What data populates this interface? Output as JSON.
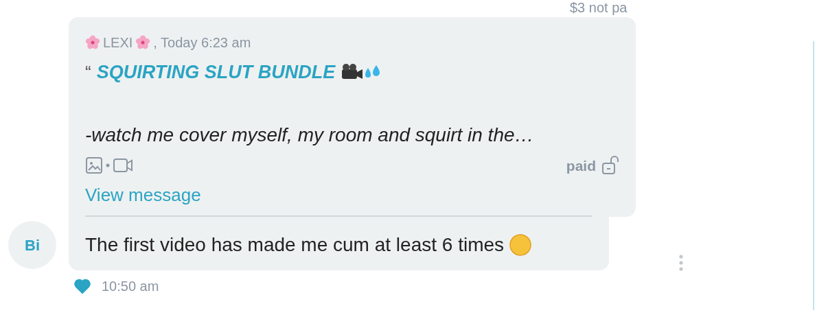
{
  "top_note": "$3 not pa",
  "avatar": {
    "initials": "Bi"
  },
  "quoted": {
    "sender": "LEXI",
    "time": ", Today 6:23 am",
    "quote_mark": "“",
    "title": "SQUIRTING SLUT BUNDLE",
    "preview": "-watch me cover myself, my room and squirt in the…",
    "status": "paid",
    "link": "View message"
  },
  "message": {
    "text": "The first video has made me cum at least 6 times",
    "liked": true,
    "time": "10:50 am"
  }
}
